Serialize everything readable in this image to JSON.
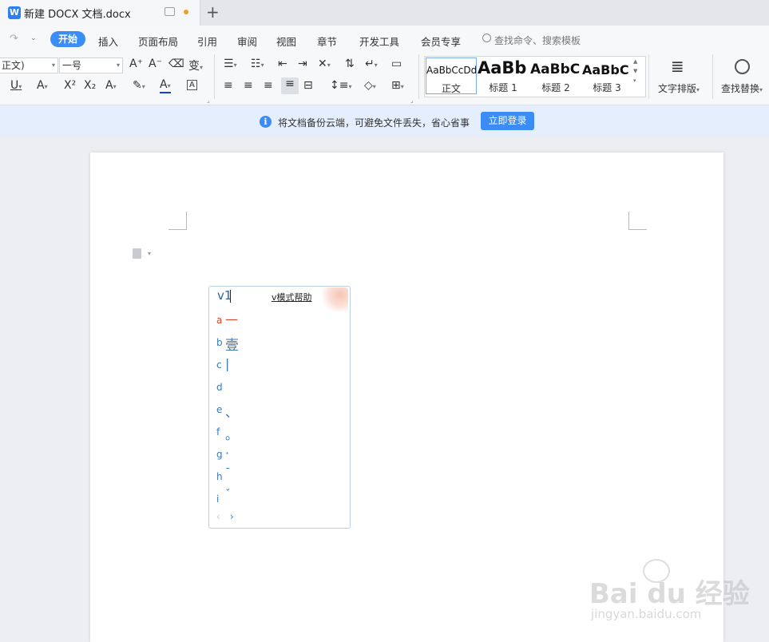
{
  "window": {
    "title": "新建 DOCX 文档.docx",
    "new_tab_glyph": "+"
  },
  "ribbon": {
    "tabs": [
      "开始",
      "插入",
      "页面布局",
      "引用",
      "审阅",
      "视图",
      "章节",
      "开发工具",
      "会员专享"
    ],
    "search_placeholder": "查找命令、搜索模板",
    "font_name": "正文)",
    "font_size": "一号",
    "styles": [
      {
        "sample": "AaBbCcDd",
        "label": "正文"
      },
      {
        "sample": "AaBb",
        "label": "标题 1"
      },
      {
        "sample": "AaBbC",
        "label": "标题 2"
      },
      {
        "sample": "AaBbC",
        "label": "标题 3"
      }
    ],
    "text_layout_label": "文字排版",
    "find_replace_label": "查找替换"
  },
  "notice": {
    "text": "将文档备份云端，可避免文件丢失，省心省事",
    "button": "立即登录"
  },
  "ime": {
    "input": "v1",
    "help_link": "v模式帮助",
    "candidates": [
      {
        "key": "a",
        "char": "—"
      },
      {
        "key": "b",
        "char": "壹"
      },
      {
        "key": "c",
        "char": "|"
      },
      {
        "key": "d",
        "char": ""
      },
      {
        "key": "e",
        "char": "、"
      },
      {
        "key": "f",
        "char": "。"
      },
      {
        "key": "g",
        "char": "·"
      },
      {
        "key": "h",
        "char": "ˉ"
      },
      {
        "key": "i",
        "char": "ˇ"
      }
    ],
    "prev_glyph": "‹",
    "next_glyph": "›"
  },
  "watermark": {
    "main": "Bai du 经验",
    "sub": "jingyan.baidu.com"
  }
}
